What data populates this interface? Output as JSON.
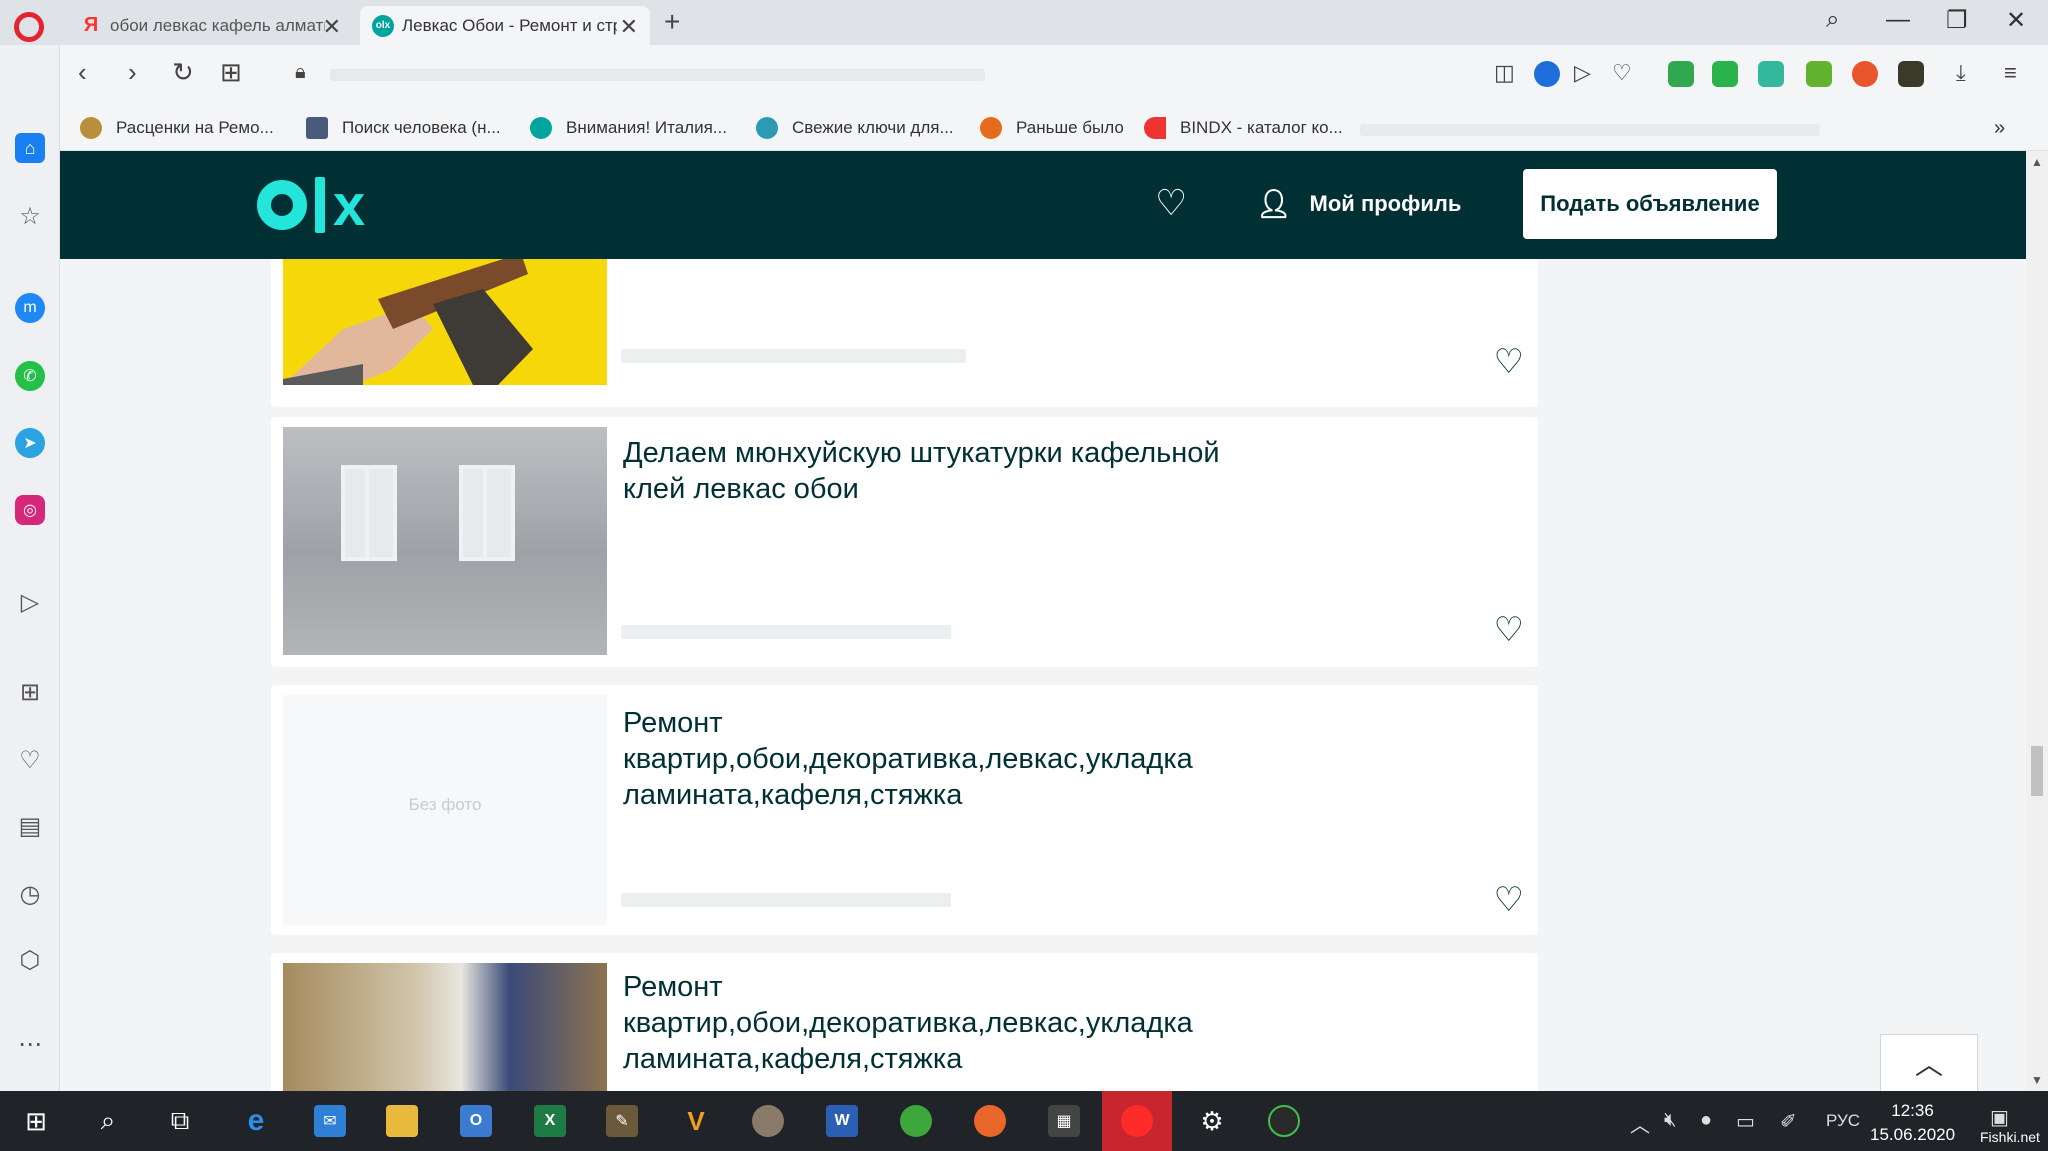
{
  "tabs": [
    {
      "title": "обои левкас кафель алматы",
      "favicon": "yandex-icon",
      "active": false
    },
    {
      "title": "Левкас Обои - Ремонт и строительство",
      "favicon": "olx-icon",
      "active": true
    }
  ],
  "bookmarks": [
    {
      "label": "Расценки на Ремо..."
    },
    {
      "label": "Поиск человека (н..."
    },
    {
      "label": "Внимания! Италия..."
    },
    {
      "label": "Свежие ключи для..."
    },
    {
      "label": "Раньше было"
    },
    {
      "label": "BINDX - каталог ко..."
    }
  ],
  "header": {
    "logo": "olx",
    "profile_label": "Мой профиль",
    "post_ad_label": "Подать объявление"
  },
  "listings": [
    {
      "title": "",
      "thumbnail": "photo-paintbrush",
      "favorite_icon": "heart-icon"
    },
    {
      "title": "Делаем мюнхуйскую штукатурки кафельной клей левкас обои",
      "thumbnail": "photo-house-facade",
      "favorite_icon": "heart-icon"
    },
    {
      "title": "Ремонт квартир,обои,декоративка,левкас,укладка ламината,кафеля,стяжка",
      "thumbnail": "",
      "no_photo_label": "Без фото",
      "favorite_icon": "heart-icon"
    },
    {
      "title": "Ремонт квартир,обои,декоративка,левкас,укладка ламината,кафеля,стяжка",
      "thumbnail": "photo-interior",
      "favorite_icon": "heart-icon"
    }
  ],
  "taskbar": {
    "language": "РУС",
    "time": "12:36",
    "date": "15.06.2020",
    "watermark": "Fishki.net"
  },
  "colors": {
    "olx_header_bg": "#002f34",
    "olx_accent": "#23e5db",
    "opera_red": "#e2242e"
  }
}
